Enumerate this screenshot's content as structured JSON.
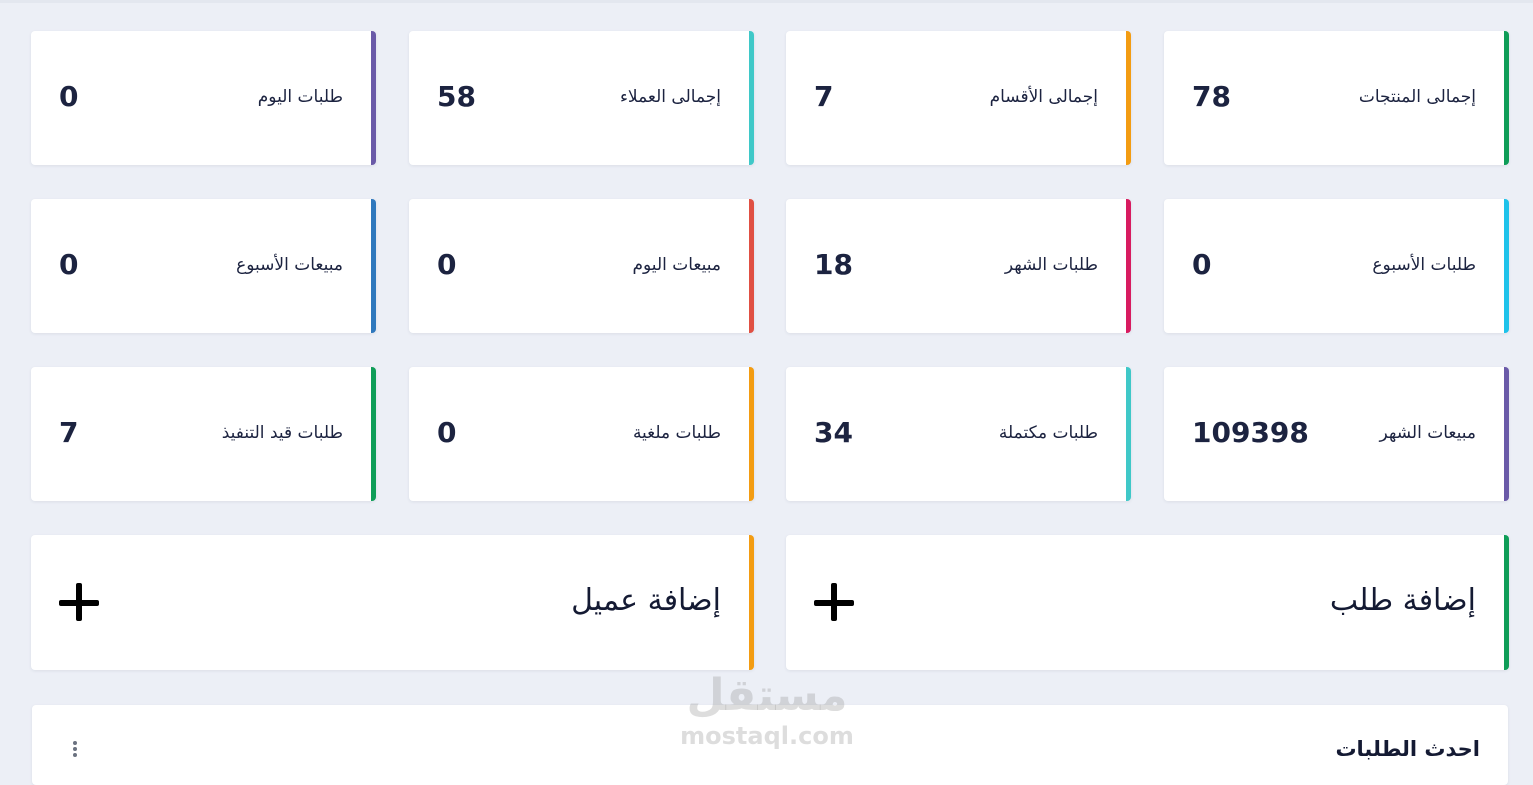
{
  "stats": [
    {
      "label": "إجمالى المنتجات",
      "value": "78",
      "color": "#0f9d58"
    },
    {
      "label": "إجمالى الأقسام",
      "value": "7",
      "color": "#f39c12"
    },
    {
      "label": "إجمالى العملاء",
      "value": "58",
      "color": "#3fc8c8"
    },
    {
      "label": "طلبات اليوم",
      "value": "0",
      "color": "#6a5aa8"
    },
    {
      "label": "طلبات الأسبوع",
      "value": "0",
      "color": "#1ec2ea"
    },
    {
      "label": "طلبات الشهر",
      "value": "18",
      "color": "#d81b60"
    },
    {
      "label": "مبيعات اليوم",
      "value": "0",
      "color": "#e05043"
    },
    {
      "label": "مبيعات الأسبوع",
      "value": "0",
      "color": "#2f78bd"
    },
    {
      "label": "مبيعات الشهر",
      "value": "109398",
      "color": "#6a5aa8"
    },
    {
      "label": "طلبات مكتملة",
      "value": "34",
      "color": "#3fc8c8"
    },
    {
      "label": "طلبات ملغية",
      "value": "0",
      "color": "#f39c12"
    },
    {
      "label": "طلبات قيد التنفيذ",
      "value": "7",
      "color": "#0f9d58"
    }
  ],
  "actions": [
    {
      "label": "إضافة طلب",
      "icon": "plus-icon",
      "color": "#0f9d58"
    },
    {
      "label": "إضافة عميل",
      "icon": "plus-icon",
      "color": "#f39c12"
    }
  ],
  "recent_orders": {
    "title": "احدث الطلبات",
    "menu_icon": "kebab-icon"
  },
  "watermark": {
    "logo": "مستقل",
    "url": "mostaql.com"
  }
}
